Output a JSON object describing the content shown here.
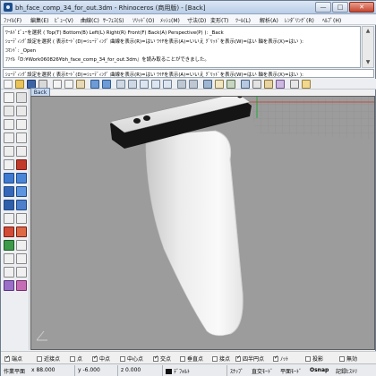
{
  "window": {
    "title": "bh_face_comp_34_for_out.3dm - Rhinoceros (商用版) - [Back]",
    "minimize_label": "—",
    "maximize_label": "□",
    "close_label": "✕"
  },
  "menu": {
    "items": [
      "ﾌｧｲﾙ(F)",
      "編集(E)",
      "ﾋﾞｭｰ(V)",
      "曲線(C)",
      "ｻｰﾌｪｽ(S)",
      "ｿﾘｯﾄﾞ(O)",
      "ﾒｯｼｭ(M)",
      "寸法(D)",
      "変形(T)",
      "ﾂｰﾙ(L)",
      "解析(A)",
      "ﾚﾝﾀﾞﾘﾝｸﾞ(R)",
      "ﾍﾙﾌﾟ(H)"
    ]
  },
  "history": {
    "lines": [
      "ﾜｰﾙﾄﾞﾋﾞｭｰを選択 ( Top(T)  Bottom(B)  Left(L)  Right(R)  Front(F)  Back(A)  Perspective(P) ): _Back",
      "ｼｪｰﾃﾞｨﾝｸﾞ設定を選択 ( 表示ﾓｰﾄﾞ(D)=ｼｪｰﾃﾞｨﾝｸﾞ  曲線を表示(R)=はい  ﾜｲﾔを表示(A)=いいえ  ｸﾞﾘｯﾄﾞを表示(W)=はい  軸を表示(X)=はい ):",
      "ｺﾏﾝﾄﾞ: _Open",
      "ﾌｧｲﾙ『D:¥Work060826¥bh_face_comp_34_for_out.3dm』を読み取ることができました。"
    ],
    "command_prompt": "ｼｪｰﾃﾞｨﾝｸﾞ設定を選択 ( 表示ﾓｰﾄﾞ(D)=ｼｪｰﾃﾞｨﾝｸﾞ  曲線を表示(R)=はい  ﾜｲﾔを表示(A)=いいえ  ｸﾞﾘｯﾄﾞを表示(W)=はい  軸を表示(X)=はい ):"
  },
  "viewport": {
    "tab_label": "Back",
    "background_color": "#9c9c9c"
  },
  "osnap": {
    "items": [
      {
        "label": "端点",
        "checked": true
      },
      {
        "label": "近接点",
        "checked": false
      },
      {
        "label": "点",
        "checked": false
      },
      {
        "label": "中点",
        "checked": true
      },
      {
        "label": "中心点",
        "checked": false
      },
      {
        "label": "交点",
        "checked": true
      },
      {
        "label": "垂直点",
        "checked": false
      },
      {
        "label": "接点",
        "checked": false
      },
      {
        "label": "四半円点",
        "checked": true
      },
      {
        "label": "ﾉｯﾄ",
        "checked": true
      },
      {
        "label": "投影",
        "checked": false
      },
      {
        "label": "無効",
        "checked": false
      }
    ]
  },
  "status": {
    "cplane": "作業平面",
    "x": "x 88.000",
    "y": "y -6.000",
    "z": "z 0.000",
    "layer": "ﾃﾞﾌｫﾙﾄ",
    "snap": "ｽﾅｯﾌﾟ",
    "ortho": "直交ﾓｰﾄﾞ",
    "planar": "平面ﾓｰﾄﾞ",
    "osnap": "Osnap",
    "record_history": "記録ﾋｽﾄﾘ"
  },
  "colors": {
    "titlebar": "#b9cde6",
    "viewport": "#9c9c9c",
    "model_surface": "#f2f2f2",
    "model_bracket": "#1a1a1a"
  }
}
